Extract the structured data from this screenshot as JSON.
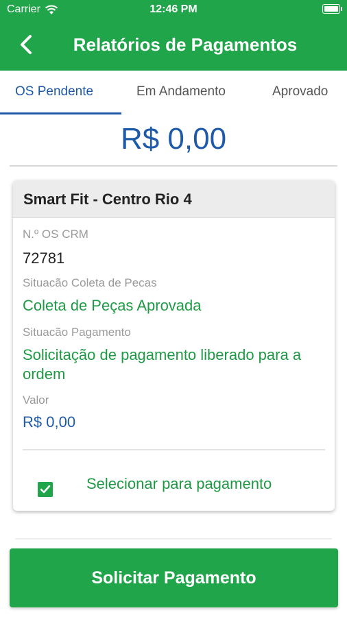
{
  "status_bar": {
    "carrier": "Carrier",
    "time": "12:46 PM",
    "wifi_icon": "wifi-icon",
    "battery_icon": "battery-icon"
  },
  "header": {
    "title": "Relatórios de Pagamentos",
    "back_icon": "chevron-left-icon"
  },
  "tabs": [
    {
      "label": "OS Pendente",
      "active": true
    },
    {
      "label": "Em Andamento",
      "active": false
    },
    {
      "label": "Aprovado",
      "active": false
    }
  ],
  "total": "R$ 0,00",
  "card": {
    "title": "Smart Fit - Centro Rio 4",
    "os_label": "N.º OS CRM",
    "os_value": "72781",
    "coleta_label": "Situacão Coleta de Pecas",
    "coleta_value": "Coleta de Peças Aprovada",
    "pagamento_label": "Situacão Pagamento",
    "pagamento_value": "Solicitação de pagamento liberado para a ordem",
    "valor_label": "Valor",
    "valor_value": "R$ 0,00",
    "select_label": "Selecionar para pagamento",
    "selected": true
  },
  "cta_label": "Solicitar Pagamento",
  "colors": {
    "brand_green": "#20a54a",
    "text_green": "#1f9a44",
    "accent_blue": "#1e5aa8"
  }
}
